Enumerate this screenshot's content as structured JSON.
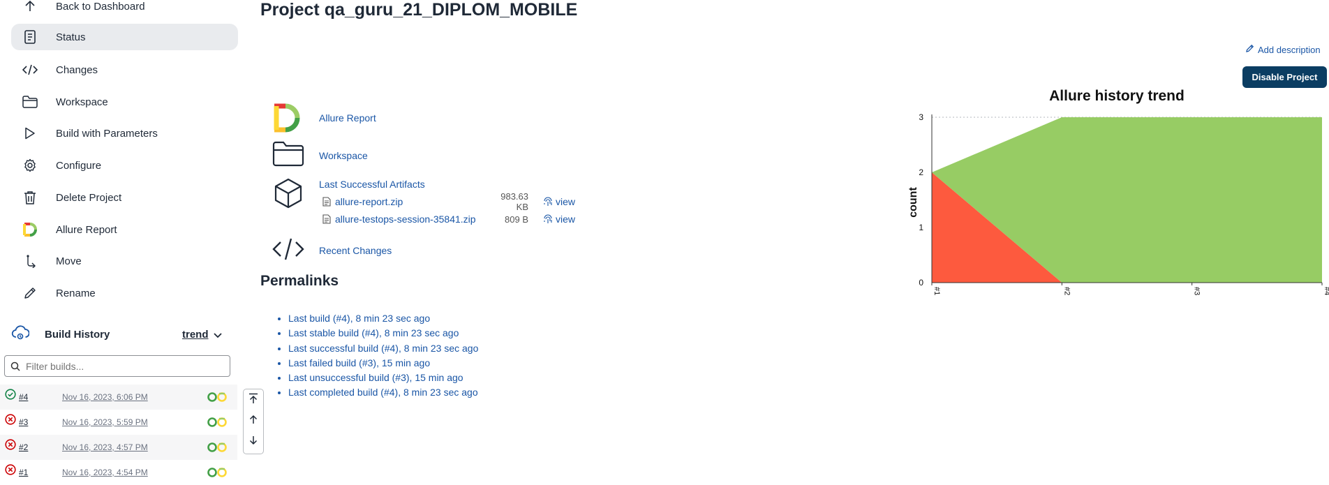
{
  "sidebar": {
    "items": [
      {
        "label": "Back to Dashboard",
        "icon": "arrow-up-icon"
      },
      {
        "label": "Status",
        "icon": "document-icon"
      },
      {
        "label": "Changes",
        "icon": "code-icon"
      },
      {
        "label": "Workspace",
        "icon": "folder-icon"
      },
      {
        "label": "Build with Parameters",
        "icon": "play-icon"
      },
      {
        "label": "Configure",
        "icon": "gear-icon"
      },
      {
        "label": "Delete Project",
        "icon": "trash-icon"
      },
      {
        "label": "Allure Report",
        "icon": "allure-logo-icon"
      },
      {
        "label": "Move",
        "icon": "move-icon"
      },
      {
        "label": "Rename",
        "icon": "pencil-icon"
      }
    ],
    "build_history": {
      "title": "Build History",
      "trend_label": "trend",
      "filter_placeholder": "Filter builds...",
      "builds": [
        {
          "number": "#4",
          "date": "Nov 16, 2023, 6:06 PM",
          "status": "success"
        },
        {
          "number": "#3",
          "date": "Nov 16, 2023, 5:59 PM",
          "status": "failed"
        },
        {
          "number": "#2",
          "date": "Nov 16, 2023, 4:57 PM",
          "status": "failed"
        },
        {
          "number": "#1",
          "date": "Nov 16, 2023, 4:54 PM",
          "status": "failed"
        }
      ]
    }
  },
  "main": {
    "title": "Project qa_guru_21_DIPLOM_MOBILE",
    "add_description": "Add description",
    "disable_button": "Disable Project",
    "links": {
      "allure_report": "Allure Report",
      "workspace": "Workspace",
      "last_successful_artifacts": "Last Successful Artifacts",
      "recent_changes": "Recent Changes"
    },
    "artifacts": [
      {
        "name": "allure-report.zip",
        "size": "983.63 KB",
        "view": "view"
      },
      {
        "name": "allure-testops-session-35841.zip",
        "size": "809 B",
        "view": "view"
      }
    ],
    "permalinks_title": "Permalinks",
    "permalinks": [
      "Last build (#4), 8 min 23 sec ago",
      "Last stable build (#4), 8 min 23 sec ago",
      "Last successful build (#4), 8 min 23 sec ago",
      "Last failed build (#3), 15 min ago",
      "Last unsuccessful build (#3), 15 min ago",
      "Last completed build (#4), 8 min 23 sec ago"
    ]
  },
  "colors": {
    "accent": "#0b3d62",
    "link": "#1a56a6",
    "passed": "#97cc64",
    "failed": "#fd5a3e",
    "success_icon": "#138347",
    "failed_icon": "#cc0003"
  },
  "chart_data": {
    "type": "area",
    "title": "Allure history trend",
    "ylabel": "count",
    "xlabel": "",
    "categories": [
      "#1",
      "#2",
      "#3",
      "#4"
    ],
    "series": [
      {
        "values": [
          2,
          0,
          0,
          0
        ],
        "color": "#fd5a3e"
      },
      {
        "values": [
          0,
          3,
          3,
          3
        ],
        "color": "#97cc64"
      }
    ],
    "stacked": true,
    "ylim": [
      0,
      3
    ],
    "yticks": [
      "0",
      "1",
      "2",
      "3"
    ],
    "grid": true
  }
}
